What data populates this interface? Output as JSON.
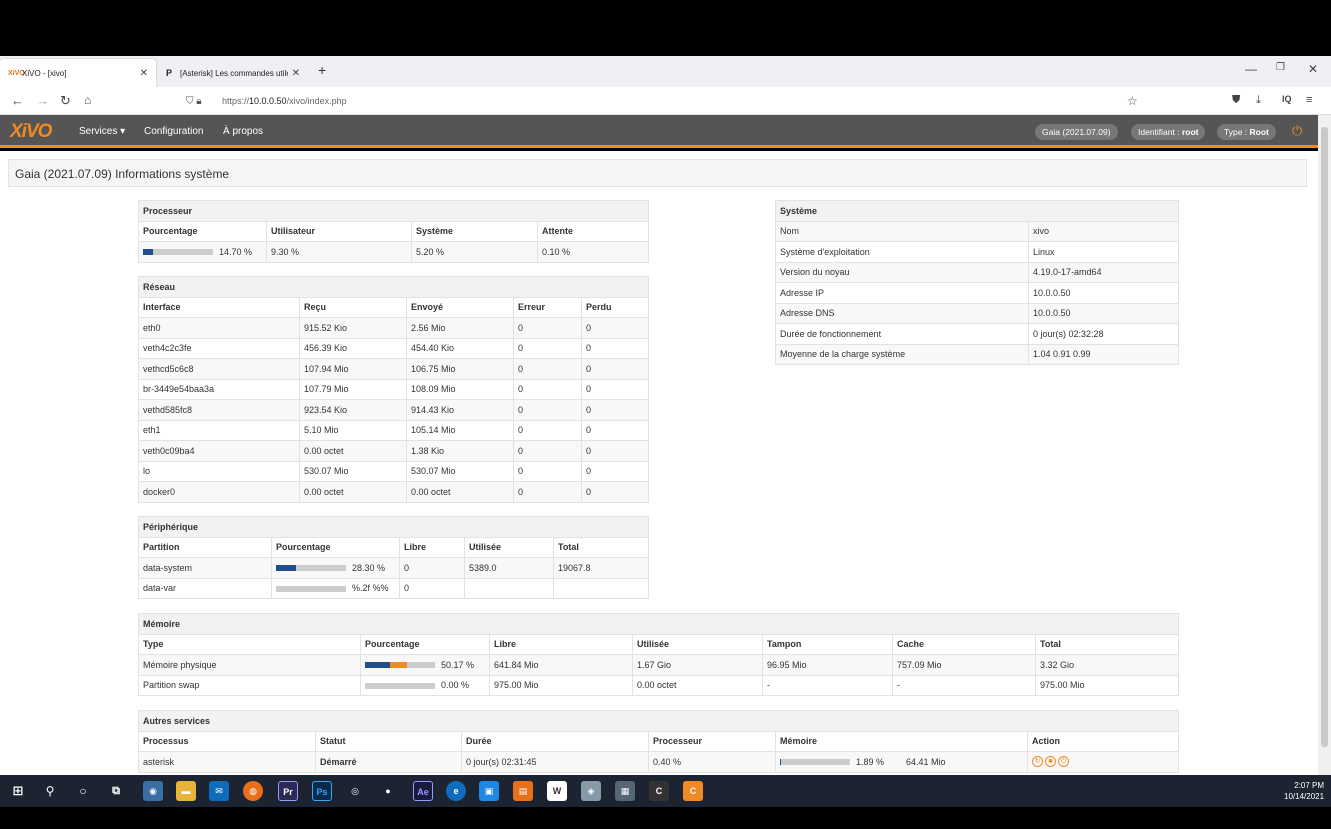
{
  "browser": {
    "tabs": [
      {
        "favicon": "xivo-favicon",
        "title": "XiVO - [xivo]",
        "active": true
      },
      {
        "favicon": "P",
        "title": "[Asterisk] Les commandes utile",
        "active": false
      }
    ],
    "url_prefix": "https://",
    "url_host": "10.0.0.50",
    "url_path": "/xivo/index.php"
  },
  "app": {
    "logo": "XiVO",
    "menu": [
      "Services ▾",
      "Configuration",
      "À propos"
    ],
    "version_pill": "Gaia (2021.07.09)",
    "identifiant_label": "Identifiant : ",
    "identifiant_value": "root",
    "type_label": "Type : ",
    "type_value": "Root"
  },
  "page_title": "Gaia (2021.07.09) Informations système",
  "processeur": {
    "caption": "Processeur",
    "headers": [
      "Pourcentage",
      "Utilisateur",
      "Système",
      "Attente"
    ],
    "pourcentage": "14.70 %",
    "pourcentage_fraction": 0.147,
    "utilisateur": "9.30 %",
    "systeme": "5.20 %",
    "attente": "0.10 %"
  },
  "reseau": {
    "caption": "Réseau",
    "headers": [
      "Interface",
      "Reçu",
      "Envoyé",
      "Erreur",
      "Perdu"
    ],
    "rows": [
      [
        "eth0",
        "915.52 Kio",
        "2.56 Mio",
        "0",
        "0"
      ],
      [
        "veth4c2c3fe",
        "456.39 Kio",
        "454.40 Kio",
        "0",
        "0"
      ],
      [
        "vethcd5c6c8",
        "107.94 Mio",
        "106.75 Mio",
        "0",
        "0"
      ],
      [
        "br-3449e54baa3a",
        "107.79 Mio",
        "108.09 Mio",
        "0",
        "0"
      ],
      [
        "vethd585fc8",
        "923.54 Kio",
        "914.43 Kio",
        "0",
        "0"
      ],
      [
        "eth1",
        "5.10 Mio",
        "105.14 Mio",
        "0",
        "0"
      ],
      [
        "veth0c09ba4",
        "0.00 octet",
        "1.38 Kio",
        "0",
        "0"
      ],
      [
        "lo",
        "530.07 Mio",
        "530.07 Mio",
        "0",
        "0"
      ],
      [
        "docker0",
        "0.00 octet",
        "0.00 octet",
        "0",
        "0"
      ]
    ]
  },
  "peripherique": {
    "caption": "Périphérique",
    "headers": [
      "Partition",
      "Pourcentage",
      "Libre",
      "Utilisée",
      "Total"
    ],
    "rows": [
      {
        "partition": "data-system",
        "pct": "28.30 %",
        "fraction": 0.283,
        "libre": "0",
        "utilisee": "5389.0",
        "total": "19067.8"
      },
      {
        "partition": "data-var",
        "pct": "%.2f %%",
        "fraction": 0,
        "libre": "0",
        "utilisee": "",
        "total": ""
      }
    ]
  },
  "systeme": {
    "caption": "Système",
    "rows": [
      [
        "Nom",
        "xivo"
      ],
      [
        "Système d'exploitation",
        "Linux"
      ],
      [
        "Version du noyau",
        "4.19.0-17-amd64"
      ],
      [
        "Adresse IP",
        "10.0.0.50"
      ],
      [
        "Adresse DNS",
        "10.0.0.50"
      ],
      [
        "Durée de fonctionnement",
        "0 jour(s) 02:32:28"
      ],
      [
        "Moyenne de la charge système",
        "1.04 0.91 0.99"
      ]
    ]
  },
  "memoire": {
    "caption": "Mémoire",
    "headers": [
      "Type",
      "Pourcentage",
      "Libre",
      "Utilisée",
      "Tampon",
      "Cache",
      "Total"
    ],
    "rows": [
      {
        "type": "Mémoire physique",
        "pct": "50.17 %",
        "fraction": 0.5017,
        "cache_fraction": 0.25,
        "libre": "641.84 Mio",
        "utilisee": "1.67 Gio",
        "tampon": "96.95 Mio",
        "cache": "757.09 Mio",
        "total": "3.32 Gio"
      },
      {
        "type": "Partition swap",
        "pct": "0.00 %",
        "fraction": 0,
        "cache_fraction": 0,
        "libre": "975.00 Mio",
        "utilisee": "0.00 octet",
        "tampon": "-",
        "cache": "-",
        "total": "975.00 Mio"
      }
    ]
  },
  "services": {
    "caption": "Autres services",
    "headers": [
      "Processus",
      "Statut",
      "Durée",
      "Processeur",
      "Mémoire",
      "Action"
    ],
    "rows": [
      {
        "processus": "asterisk",
        "statut": "Démarré",
        "duree": "0 jour(s) 02:31:45",
        "processeur": "0.40 %",
        "mem_pct": "1.89 %",
        "mem_fraction": 0.0189,
        "memoire": "64.41 Mio"
      }
    ]
  },
  "taskbar": {
    "time": "2:07 PM",
    "date": "10/14/2021"
  },
  "colors": {
    "accent": "#f08a24",
    "header_bg": "#555555",
    "bar_fill": "#1f4e8a"
  }
}
